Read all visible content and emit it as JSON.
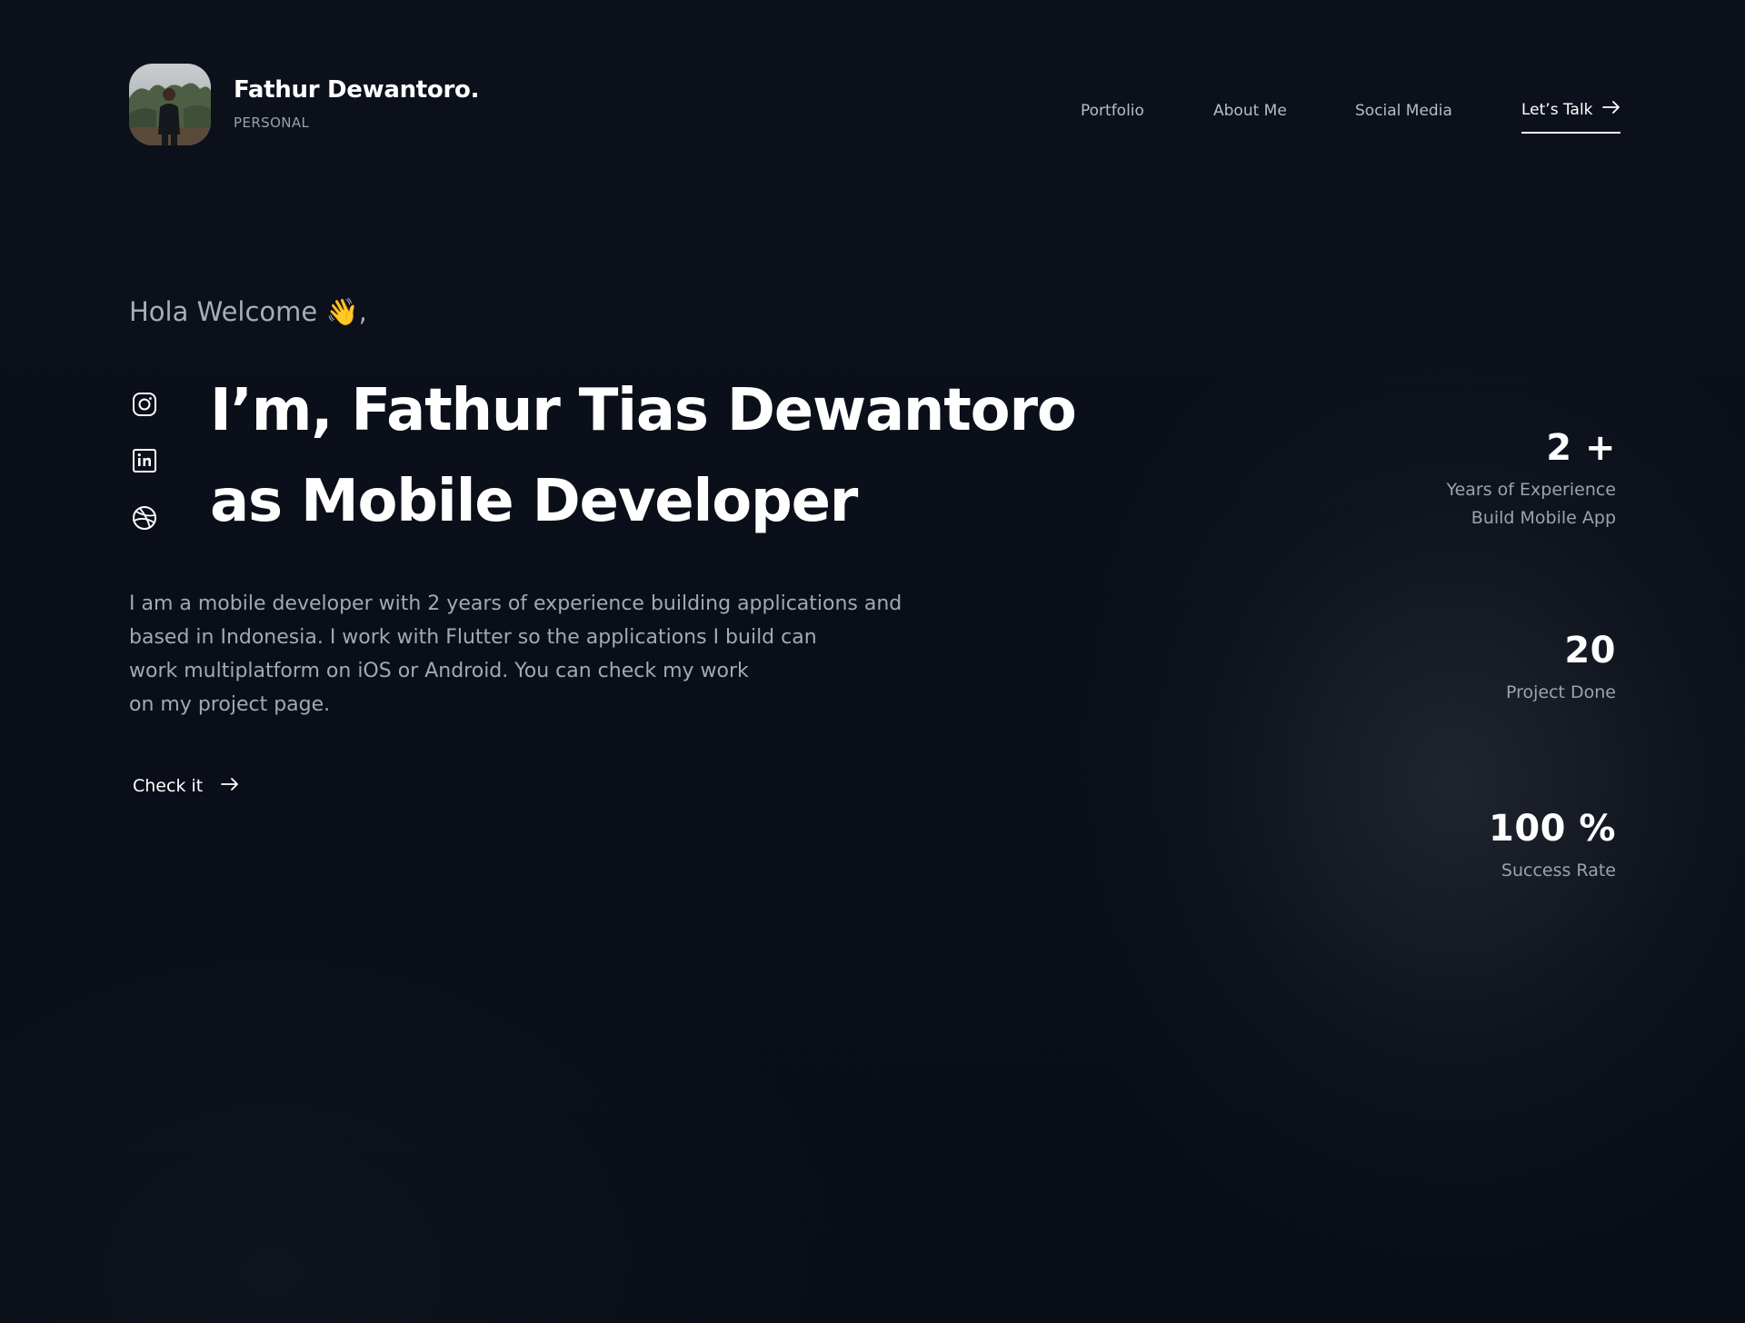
{
  "header": {
    "name": "Fathur Dewantoro.",
    "subtitle": "PERSONAL",
    "avatar_icon": "profile-photo"
  },
  "nav": {
    "items": [
      {
        "label": "Portfolio"
      },
      {
        "label": "About Me"
      },
      {
        "label": "Social Media"
      }
    ],
    "cta": {
      "label": "Let’s Talk",
      "icon": "arrow-right-icon"
    }
  },
  "hero": {
    "greeting": "Hola Welcome 👋,",
    "headline_line1": "I’m, Fathur Tias Dewantoro",
    "headline_line2": "as Mobile Developer",
    "bio_lines": [
      "I am a mobile developer with 2 years of experience building applications and",
      "based in Indonesia. I work with Flutter so the applications I build can",
      "work multiplatform on iOS or Android. You can check my work",
      "on my project page."
    ],
    "cta": {
      "label": "Check it",
      "icon": "arrow-right-icon"
    }
  },
  "social_icons": [
    "instagram-icon",
    "linkedin-icon",
    "dribbble-icon"
  ],
  "stats": [
    {
      "value": "2 +",
      "label_line1": "Years of Experience",
      "label_line2": "Build Mobile App"
    },
    {
      "value": "20",
      "label_line1": "Project Done"
    },
    {
      "value": "100 %",
      "label_line1": "Success Rate"
    }
  ],
  "colors": {
    "background": "#0a0e18",
    "text_primary": "#ffffff",
    "text_secondary": "#a4a8b0"
  }
}
